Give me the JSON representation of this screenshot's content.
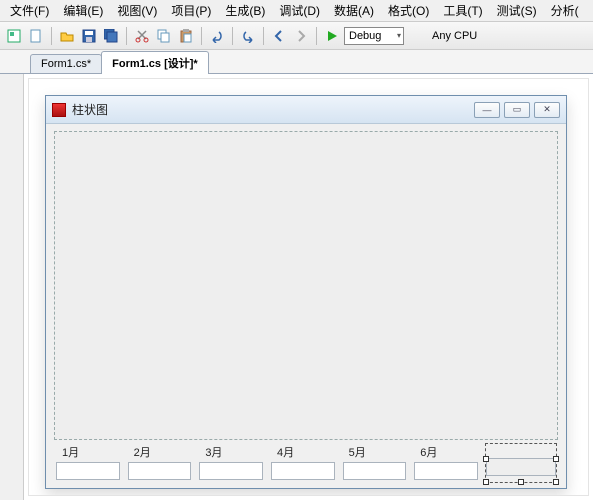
{
  "menu": {
    "file": "文件(F)",
    "edit": "编辑(E)",
    "view": "视图(V)",
    "project": "项目(P)",
    "build": "生成(B)",
    "debug": "调试(D)",
    "data": "数据(A)",
    "format": "格式(O)",
    "tools": "工具(T)",
    "test": "测试(S)",
    "analyze": "分析("
  },
  "toolbar": {
    "config": "Debug",
    "platform": "Any CPU"
  },
  "tabs": {
    "t1": "Form1.cs*",
    "t2": "Form1.cs [设计]*"
  },
  "form": {
    "title": "柱状图"
  },
  "chart_data": {
    "type": "bar",
    "categories": [
      "1月",
      "2月",
      "3月",
      "4月",
      "5月",
      "6月"
    ],
    "values": [
      null,
      null,
      null,
      null,
      null,
      null
    ],
    "title": "柱状图",
    "xlabel": "",
    "ylabel": ""
  },
  "fields": {
    "m1": "1月",
    "m2": "2月",
    "m3": "3月",
    "m4": "4月",
    "m5": "5月",
    "m6": "6月"
  }
}
